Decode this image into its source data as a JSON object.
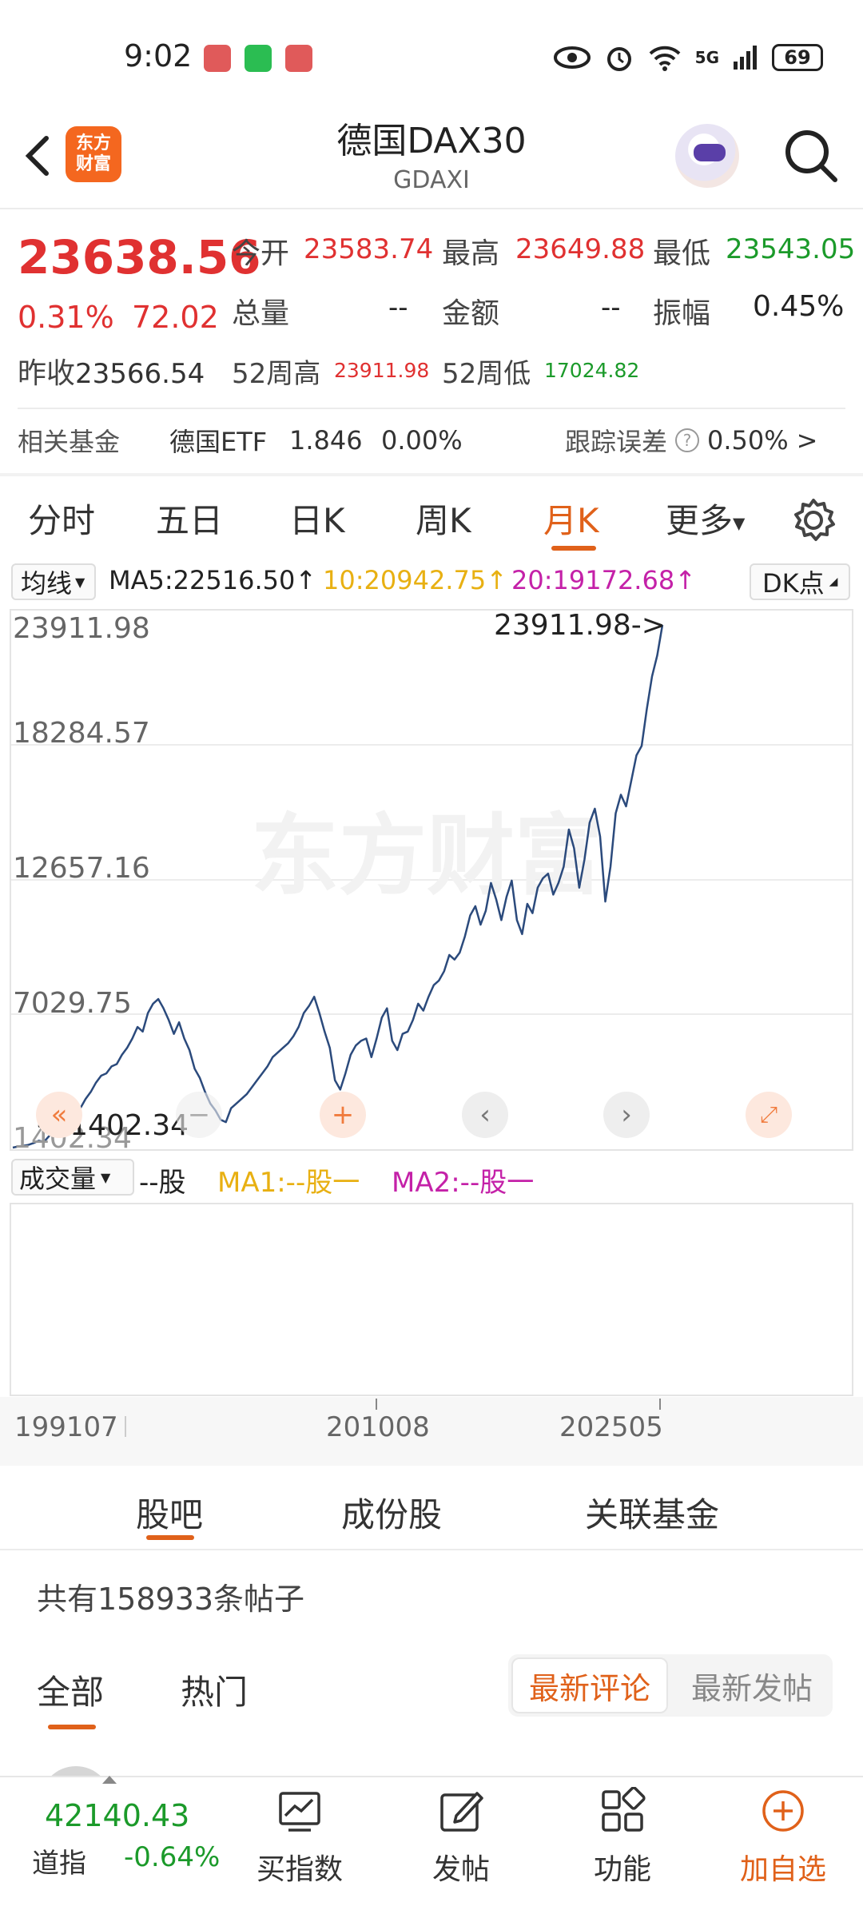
{
  "status_bar": {
    "time": "9:02",
    "network": "5G",
    "battery": "69"
  },
  "header": {
    "title": "德国DAX30",
    "subtitle": "GDAXI",
    "logo_line1": "东方",
    "logo_line2": "财富"
  },
  "quote": {
    "price": "23638.56",
    "change_pct": "0.31%",
    "change_abs": "72.02",
    "open_label": "今开",
    "open": "23583.74",
    "high_label": "最高",
    "high": "23649.88",
    "low_label": "最低",
    "low": "23543.05",
    "volume_label": "总量",
    "volume": "--",
    "amount_label": "金额",
    "amount": "--",
    "amplitude_label": "振幅",
    "amplitude": "0.45%",
    "prev_close_label": "昨收",
    "prev_close": "23566.54",
    "high52_label": "52周高",
    "high52": "23911.98",
    "low52_label": "52周低",
    "low52": "17024.82"
  },
  "fund": {
    "label": "相关基金",
    "name": "德国ETF",
    "price": "1.846",
    "change": "0.00%",
    "tracking_label": "跟踪误差",
    "tracking_value": "0.50%",
    "arrow": ">"
  },
  "chart_tabs": [
    "分时",
    "五日",
    "日K",
    "周K",
    "月K",
    "更多"
  ],
  "active_tab": "月K",
  "ma": {
    "select": "均线",
    "ma5": "MA5:22516.50↑",
    "ma10": "10:20942.75↑",
    "ma20": "20:19172.68↑",
    "dk": "DK点"
  },
  "chart_data": {
    "type": "line",
    "series": [
      {
        "values": [
          1402.34,
          1450,
          1480,
          1520,
          1600,
          1700,
          1650,
          1900,
          2100,
          2300,
          2400,
          2600,
          2800,
          3100,
          3500,
          3800,
          4200,
          4500,
          4600,
          4900,
          5000,
          5400,
          5700,
          6100,
          6600,
          6400,
          7200,
          7600,
          7800,
          7400,
          6900,
          6300,
          6800,
          6100,
          5600,
          4800,
          4400,
          3800,
          3300,
          3000,
          2600,
          2500,
          3100,
          3300,
          3500,
          3700,
          4000,
          4300,
          4600,
          4900,
          5300,
          5500,
          5700,
          5900,
          6200,
          6600,
          7200,
          7500,
          7900,
          7200,
          6400,
          5700,
          4300,
          3900,
          4600,
          5400,
          5800,
          6000,
          6100,
          5300,
          6100,
          7000,
          7400,
          6000,
          5600,
          6300,
          6400,
          6900,
          7600,
          7300,
          7900,
          8400,
          8600,
          9000,
          9700,
          9500,
          9800,
          10500,
          11400,
          11800,
          11000,
          11600,
          12800,
          12100,
          11200,
          12200,
          12900,
          11200,
          10600,
          11900,
          11500,
          12600,
          13000,
          13200,
          12300,
          12800,
          13500,
          15100,
          14300,
          12600,
          13800,
          15400,
          16000,
          14800,
          12000,
          13500,
          15800,
          16600,
          16100,
          17200,
          18300,
          18700,
          20300,
          21700,
          22600,
          23911.98
        ]
      }
    ],
    "yticks": [
      "23911.98",
      "18284.57",
      "12657.16",
      "7029.75",
      "1402.34"
    ],
    "high_label": "23911.98->",
    "low_label": "<-1402.34",
    "xticks": [
      "199107",
      "201008",
      "202505"
    ],
    "ylim": [
      1402.34,
      23911.98
    ]
  },
  "volume": {
    "select": "成交量",
    "unit": "--股",
    "ma1": "MA1:--股一",
    "ma2": "MA2:--股一"
  },
  "section_tabs": [
    "股吧",
    "成份股",
    "关联基金"
  ],
  "post_count": "共有158933条帖子",
  "filter_tabs": [
    "全部",
    "热门"
  ],
  "sort": {
    "active": "最新评论",
    "inactive": "最新发帖"
  },
  "bottom_bar": {
    "index_value": "42140.43",
    "index_name": "道指",
    "index_change": "-0.64%",
    "items": [
      "买指数",
      "发帖",
      "功能",
      "加自选"
    ]
  },
  "colors": {
    "up": "#e03131",
    "down": "#1b9a2a",
    "accent": "#e0611a",
    "line": "#2b4a7c"
  }
}
